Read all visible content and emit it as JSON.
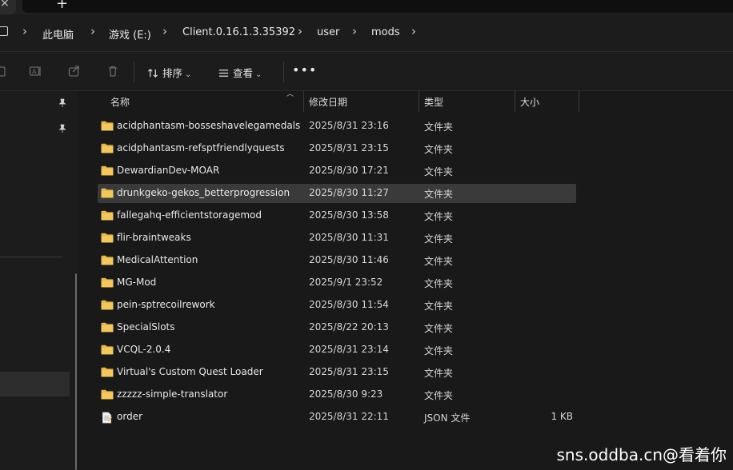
{
  "tabs": {
    "close_glyph": "×",
    "new_glyph": "+"
  },
  "breadcrumb": [
    {
      "label": "此电脑"
    },
    {
      "label": "游戏 (E:)"
    },
    {
      "label": "Client.0.16.1.3.35392"
    },
    {
      "label": "user"
    },
    {
      "label": "mods"
    }
  ],
  "breadcrumb_separator": "›",
  "toolbar": {
    "sort_label": "排序",
    "view_label": "查看",
    "caret": "⌄",
    "more_label": "•••"
  },
  "columns": {
    "name": "名称",
    "modified": "修改日期",
    "type": "类型",
    "size": "大小"
  },
  "files": [
    {
      "name": "acidphantasm-bosseshavelegamedals",
      "modified": "2025/8/31 23:16",
      "type": "文件夹",
      "size": "",
      "icon": "folder-icon"
    },
    {
      "name": "acidphantasm-refsptfriendlyquests",
      "modified": "2025/8/31 23:15",
      "type": "文件夹",
      "size": "",
      "icon": "folder-icon"
    },
    {
      "name": "DewardianDev-MOAR",
      "modified": "2025/8/30 17:21",
      "type": "文件夹",
      "size": "",
      "icon": "folder-icon"
    },
    {
      "name": "drunkgeko-gekos_betterprogression",
      "modified": "2025/8/30 11:27",
      "type": "文件夹",
      "size": "",
      "icon": "folder-icon",
      "selected": true
    },
    {
      "name": "fallegahq-efficientstoragemod",
      "modified": "2025/8/30 13:58",
      "type": "文件夹",
      "size": "",
      "icon": "folder-icon"
    },
    {
      "name": "flir-braintweaks",
      "modified": "2025/8/30 11:31",
      "type": "文件夹",
      "size": "",
      "icon": "folder-icon"
    },
    {
      "name": "MedicalAttention",
      "modified": "2025/8/30 11:46",
      "type": "文件夹",
      "size": "",
      "icon": "folder-icon"
    },
    {
      "name": "MG-Mod",
      "modified": "2025/9/1 23:52",
      "type": "文件夹",
      "size": "",
      "icon": "folder-icon"
    },
    {
      "name": "pein-sptrecoilrework",
      "modified": "2025/8/30 11:54",
      "type": "文件夹",
      "size": "",
      "icon": "folder-icon"
    },
    {
      "name": "SpecialSlots",
      "modified": "2025/8/22 20:13",
      "type": "文件夹",
      "size": "",
      "icon": "folder-icon"
    },
    {
      "name": "VCQL-2.0.4",
      "modified": "2025/8/31 23:14",
      "type": "文件夹",
      "size": "",
      "icon": "folder-icon"
    },
    {
      "name": "Virtual's Custom Quest Loader",
      "modified": "2025/8/31 23:15",
      "type": "文件夹",
      "size": "",
      "icon": "folder-icon"
    },
    {
      "name": "zzzzz-simple-translator",
      "modified": "2025/8/30 9:23",
      "type": "文件夹",
      "size": "",
      "icon": "folder-icon"
    },
    {
      "name": "order",
      "modified": "2025/8/31 22:11",
      "type": "JSON 文件",
      "size": "1 KB",
      "icon": "json-file-icon"
    }
  ],
  "watermark": "sns.oddba.cn@看着你",
  "colors": {
    "folder": "#e8b84a",
    "selected_row": "#3a3a3a",
    "background": "#191919"
  }
}
